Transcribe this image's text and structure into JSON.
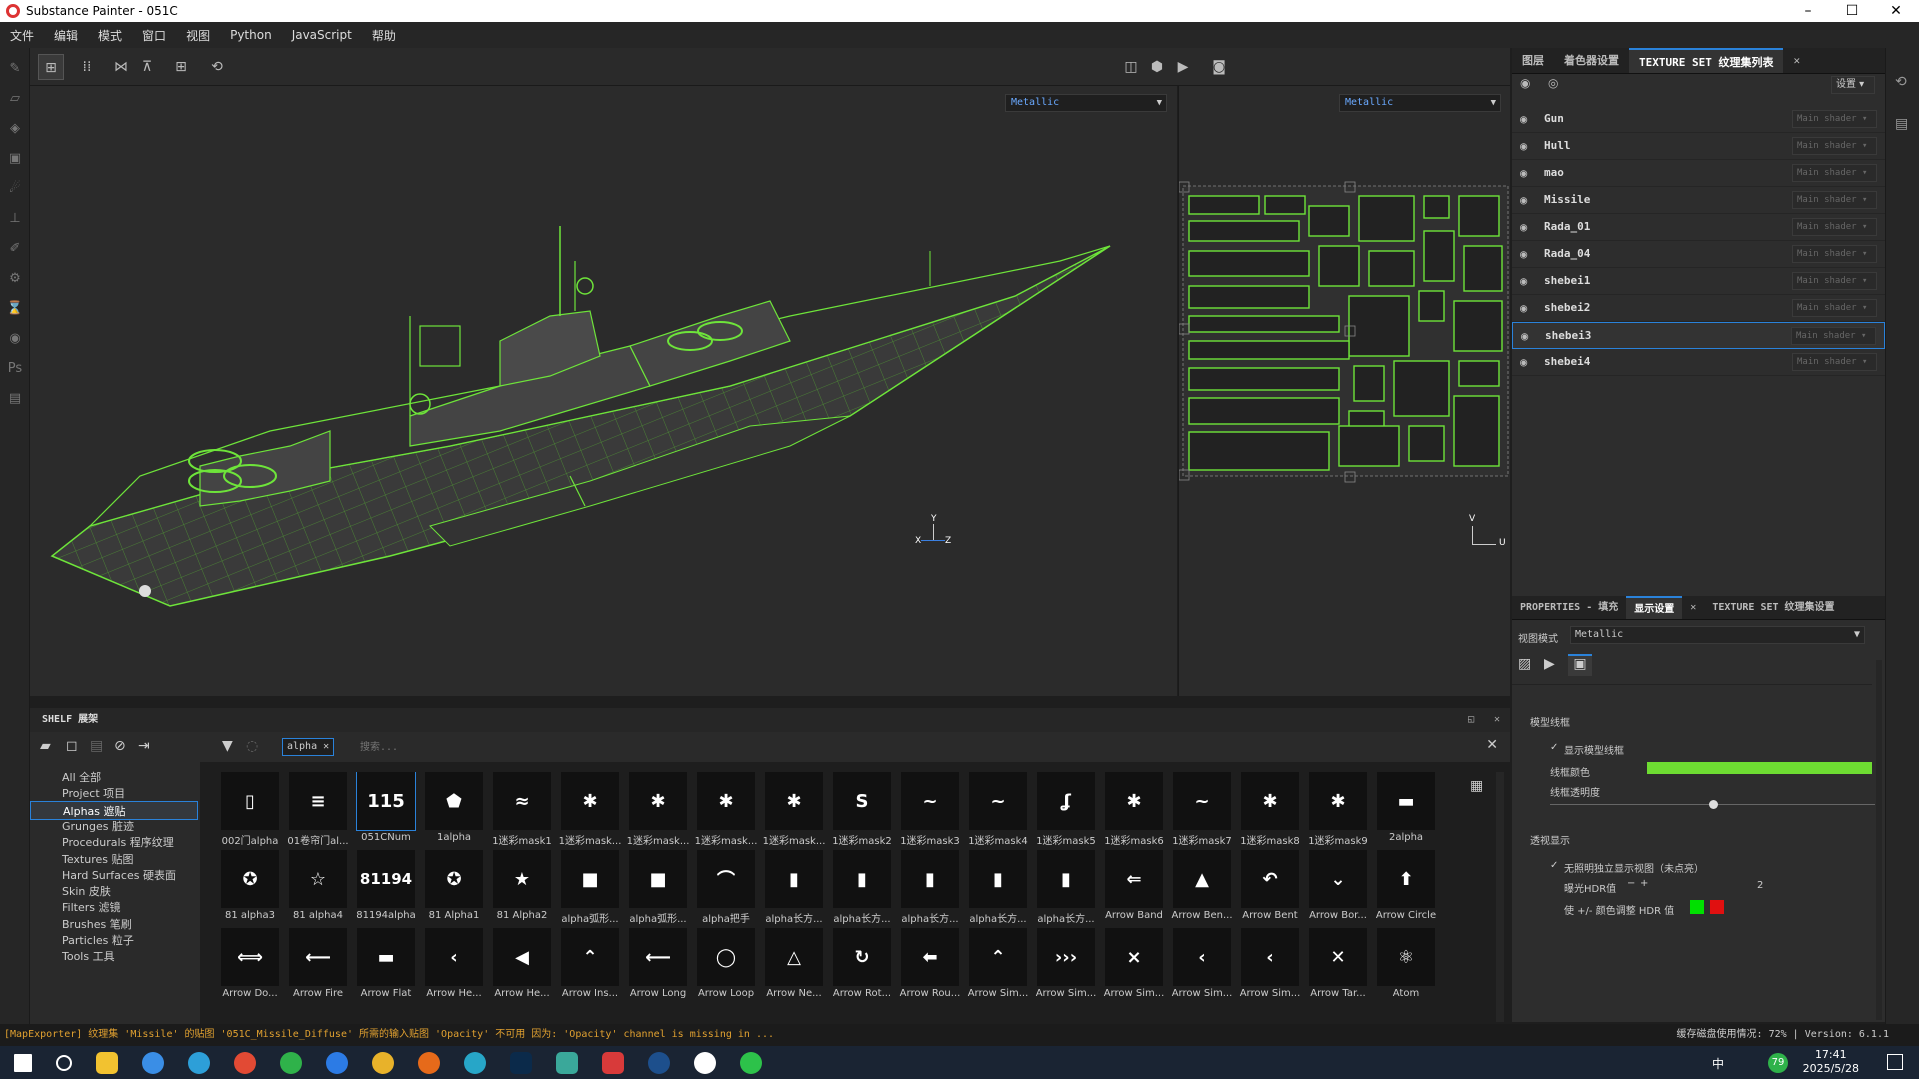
{
  "window": {
    "title": "Substance Painter - 051C"
  },
  "menu": [
    "文件",
    "编辑",
    "模式",
    "窗口",
    "视图",
    "Python",
    "JavaScript",
    "帮助"
  ],
  "viewport": {
    "channel_3d": "Metallic",
    "channel_2d": "Metallic",
    "axes_3d": [
      "Y",
      "X",
      "Z"
    ],
    "axes_2d": [
      "V",
      "U"
    ]
  },
  "right_tabs": [
    "图层",
    "着色器设置",
    "TEXTURE SET 纹理集列表"
  ],
  "texture_set": {
    "settings_label": "设置",
    "shader_placeholder": "Main shader",
    "rows": [
      "Gun",
      "Hull",
      "mao",
      "Missile",
      "Rada_01",
      "Rada_04",
      "shebei1",
      "shebei2",
      "shebei3",
      "shebei4"
    ],
    "selected": "shebei3"
  },
  "props_tabs": [
    "PROPERTIES - 填充",
    "显示设置",
    "TEXTURE SET 纹理集设置"
  ],
  "props": {
    "view_mode_label": "视图模式",
    "view_mode_value": "Metallic",
    "wireframe_section": "模型线框",
    "show_wireframe_label": "显示模型线框",
    "wire_color_label": "线框颜色",
    "wire_color": "#6edc32",
    "wire_opacity_label": "线框透明度",
    "wire_opacity": 0.5,
    "transparency_section": "透视显示",
    "isolate_label": "无照明独立显示视图（未点亮）",
    "hdr_label": "曝光HDR值",
    "hdr_value": "2",
    "hdr_adjust_label": "使 +/- 颜色调整 HDR 值"
  },
  "shelf": {
    "title": "SHELF 展架",
    "filter_tag": "alpha",
    "search_placeholder": "搜索...",
    "categories": [
      "All 全部",
      "Project 项目",
      "Alphas 遮贴",
      "Grunges 脏迹",
      "Procedurals 程序纹理",
      "Textures 贴图",
      "Hard Surfaces 硬表面",
      "Skin 皮肤",
      "Filters 滤镜",
      "Brushes 笔刷",
      "Particles 粒子",
      "Tools 工具"
    ],
    "selected_category": "Alphas 遮贴",
    "items": [
      {
        "label": "002门alpha",
        "glyph": "▯"
      },
      {
        "label": "01卷帘门al...",
        "glyph": "≡"
      },
      {
        "label": "051CNum",
        "glyph": "115"
      },
      {
        "label": "1alpha",
        "glyph": "⬟"
      },
      {
        "label": "1迷彩mask1",
        "glyph": "≈"
      },
      {
        "label": "1迷彩mask...",
        "glyph": "✱"
      },
      {
        "label": "1迷彩mask...",
        "glyph": "✱"
      },
      {
        "label": "1迷彩mask...",
        "glyph": "✱"
      },
      {
        "label": "1迷彩mask...",
        "glyph": "✱"
      },
      {
        "label": "1迷彩mask2",
        "glyph": "S"
      },
      {
        "label": "1迷彩mask3",
        "glyph": "~"
      },
      {
        "label": "1迷彩mask4",
        "glyph": "~"
      },
      {
        "label": "1迷彩mask5",
        "glyph": "ʆ"
      },
      {
        "label": "1迷彩mask6",
        "glyph": "✱"
      },
      {
        "label": "1迷彩mask7",
        "glyph": "~"
      },
      {
        "label": "1迷彩mask8",
        "glyph": "✱"
      },
      {
        "label": "1迷彩mask9",
        "glyph": "✱"
      },
      {
        "label": "2alpha",
        "glyph": "▬"
      },
      {
        "label": "81 alpha3",
        "glyph": "✪"
      },
      {
        "label": "81 alpha4",
        "glyph": "☆"
      },
      {
        "label": "81194alpha",
        "glyph": "81194"
      },
      {
        "label": "81 Alpha1",
        "glyph": "✪"
      },
      {
        "label": "81 Alpha2",
        "glyph": "★"
      },
      {
        "label": "alpha弧形...",
        "glyph": "■"
      },
      {
        "label": "alpha弧形...",
        "glyph": "■"
      },
      {
        "label": "alpha把手",
        "glyph": "⌒"
      },
      {
        "label": "alpha长方...",
        "glyph": "▮"
      },
      {
        "label": "alpha长方...",
        "glyph": "▮"
      },
      {
        "label": "alpha长方...",
        "glyph": "▮"
      },
      {
        "label": "alpha长方...",
        "glyph": "▮"
      },
      {
        "label": "alpha长方...",
        "glyph": "▮"
      },
      {
        "label": "Arrow Band",
        "glyph": "⇐"
      },
      {
        "label": "Arrow Ben...",
        "glyph": "▲"
      },
      {
        "label": "Arrow Bent",
        "glyph": "↶"
      },
      {
        "label": "Arrow Bor...",
        "glyph": "⌄"
      },
      {
        "label": "Arrow Circle",
        "glyph": "⬆"
      },
      {
        "label": "Arrow Do...",
        "glyph": "⟺"
      },
      {
        "label": "Arrow Fire",
        "glyph": "⟵"
      },
      {
        "label": "Arrow Flat",
        "glyph": "▬"
      },
      {
        "label": "Arrow He...",
        "glyph": "‹"
      },
      {
        "label": "Arrow He...",
        "glyph": "◀"
      },
      {
        "label": "Arrow Ins...",
        "glyph": "⌃"
      },
      {
        "label": "Arrow Long",
        "glyph": "⟵"
      },
      {
        "label": "Arrow Loop",
        "glyph": "◯"
      },
      {
        "label": "Arrow Ne...",
        "glyph": "△"
      },
      {
        "label": "Arrow Rot...",
        "glyph": "↻"
      },
      {
        "label": "Arrow Rou...",
        "glyph": "⬅"
      },
      {
        "label": "Arrow Sim...",
        "glyph": "⌃"
      },
      {
        "label": "Arrow Sim...",
        "glyph": "›››"
      },
      {
        "label": "Arrow Sim...",
        "glyph": "⨯"
      },
      {
        "label": "Arrow Sim...",
        "glyph": "‹"
      },
      {
        "label": "Arrow Sim...",
        "glyph": "‹"
      },
      {
        "label": "Arrow Tar...",
        "glyph": "✕"
      },
      {
        "label": "Atom",
        "glyph": "⚛"
      }
    ],
    "selected_item": "051CNum"
  },
  "status": {
    "message": "[MapExporter] 纹理集 'Missile' 的贴图 '051C_Missile_Diffuse' 所需的输入贴图 'Opacity' 不可用 因为: 'Opacity' channel is missing in ...",
    "right": "缓存磁盘使用情况: 72% | Version: 6.1.1"
  },
  "taskbar": {
    "time": "17:41",
    "date": "2025/5/28",
    "ime": "中",
    "badge": "79"
  }
}
